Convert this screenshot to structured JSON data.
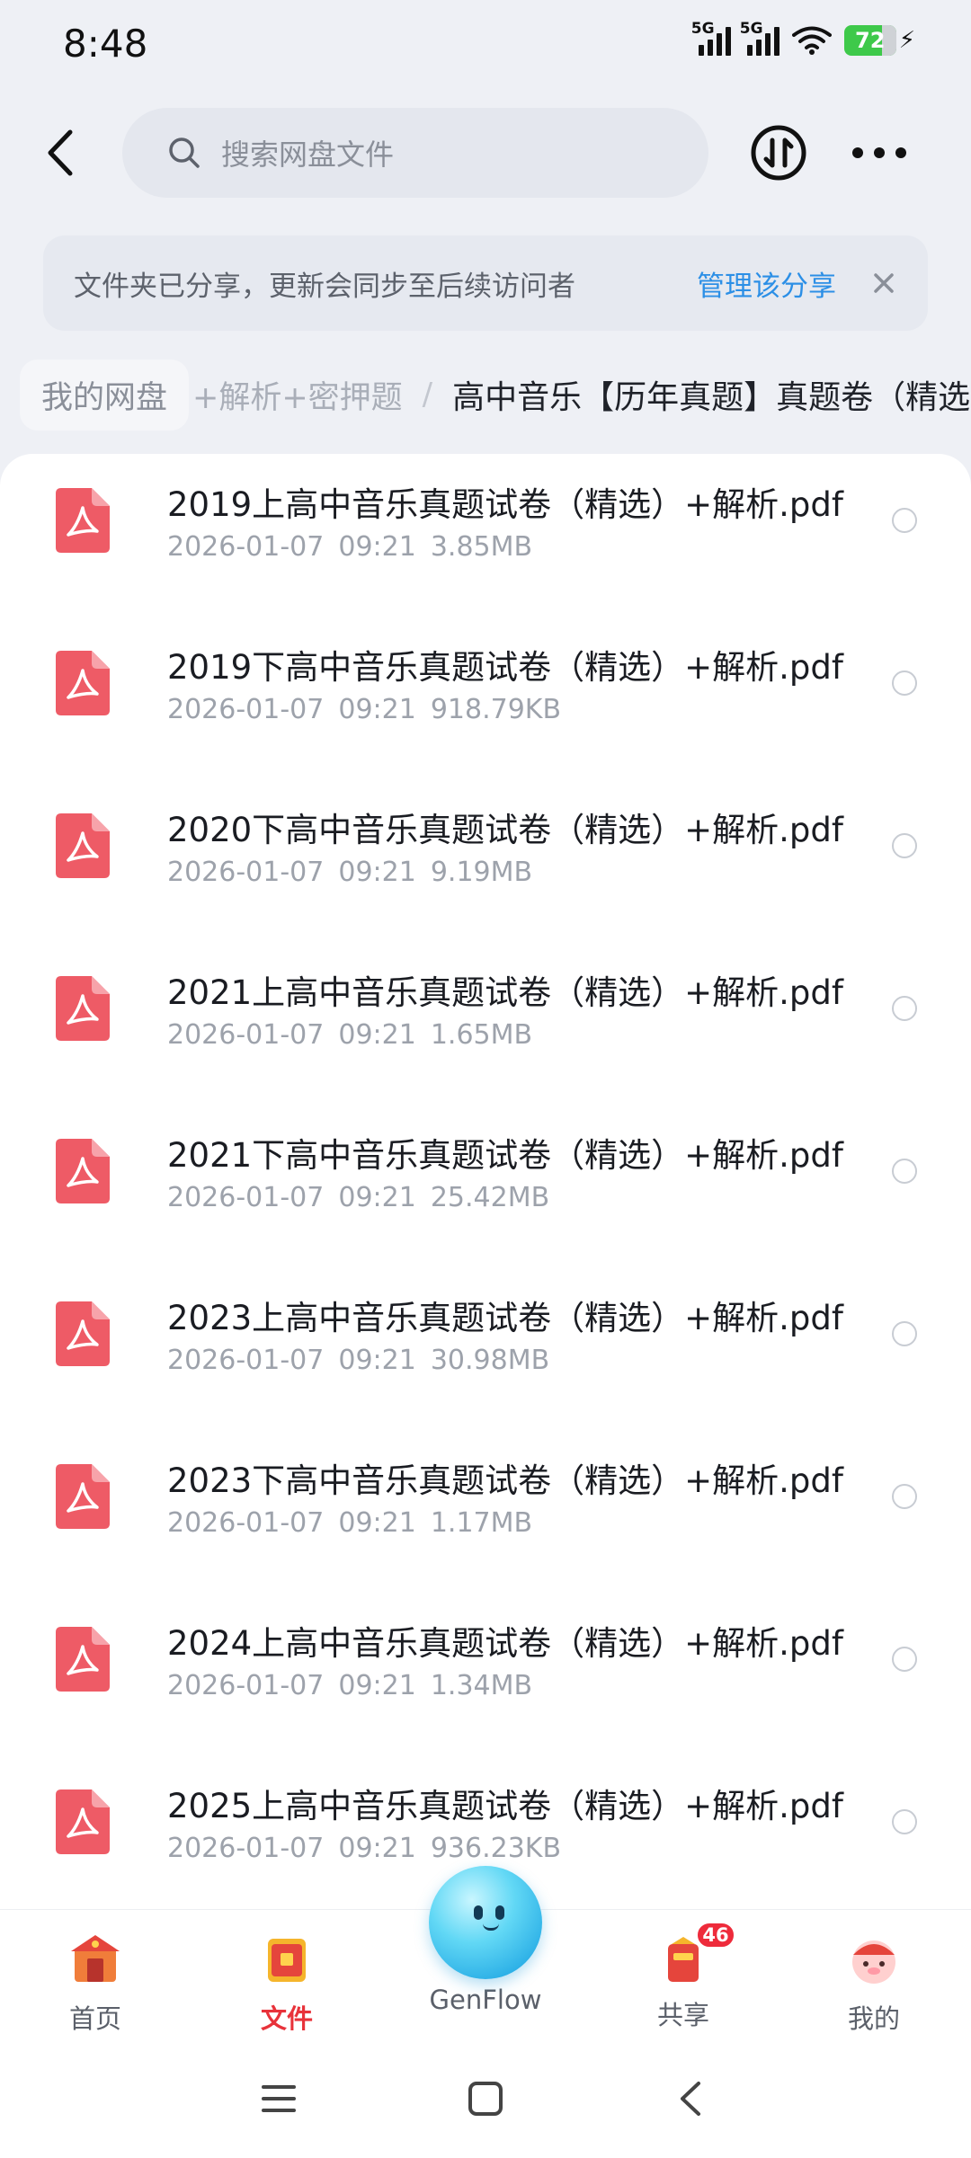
{
  "status_bar": {
    "time": "8:48",
    "signal1": "5G",
    "signal2": "5G",
    "battery": "72",
    "battery_level": 0.72
  },
  "search": {
    "placeholder": "搜索网盘文件"
  },
  "banner": {
    "text": "文件夹已分享，更新会同步至后续访问者",
    "action": "管理该分享"
  },
  "breadcrumb": {
    "root": "我的网盘",
    "middle": "+解析+密押题",
    "separator": "/",
    "current": "高中音乐【历年真题】真题卷（精选"
  },
  "files": [
    {
      "name": "2019上高中音乐真题试卷（精选）+解析.pdf",
      "date": "2026-01-07",
      "time": "09:21",
      "size": "3.85MB"
    },
    {
      "name": "2019下高中音乐真题试卷（精选）+解析.pdf",
      "date": "2026-01-07",
      "time": "09:21",
      "size": "918.79KB"
    },
    {
      "name": "2020下高中音乐真题试卷（精选）+解析.pdf",
      "date": "2026-01-07",
      "time": "09:21",
      "size": "9.19MB"
    },
    {
      "name": "2021上高中音乐真题试卷（精选）+解析.pdf",
      "date": "2026-01-07",
      "time": "09:21",
      "size": "1.65MB"
    },
    {
      "name": "2021下高中音乐真题试卷（精选）+解析.pdf",
      "date": "2026-01-07",
      "time": "09:21",
      "size": "25.42MB"
    },
    {
      "name": "2023上高中音乐真题试卷（精选）+解析.pdf",
      "date": "2026-01-07",
      "time": "09:21",
      "size": "30.98MB"
    },
    {
      "name": "2023下高中音乐真题试卷（精选）+解析.pdf",
      "date": "2026-01-07",
      "time": "09:21",
      "size": "1.17MB"
    },
    {
      "name": "2024上高中音乐真题试卷（精选）+解析.pdf",
      "date": "2026-01-07",
      "time": "09:21",
      "size": "1.34MB"
    },
    {
      "name": "2025上高中音乐真题试卷（精选）+解析.pdf",
      "date": "2026-01-07",
      "time": "09:21",
      "size": "936.23KB"
    }
  ],
  "nav": {
    "home": "首页",
    "files": "文件",
    "genflow": "GenFlow",
    "share": "共享",
    "share_badge": "46",
    "mine": "我的"
  },
  "colors": {
    "accent_link": "#2c8fe6",
    "active_tab": "#e8323a",
    "pdf_icon": "#ee5b66"
  }
}
